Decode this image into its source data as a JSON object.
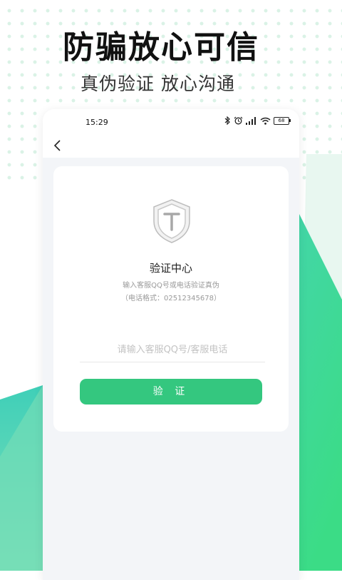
{
  "promo": {
    "headline": "防骗放心可信",
    "subheadline": "真伪验证 放心沟通"
  },
  "status_bar": {
    "time": "15:29",
    "battery": "68",
    "icons": [
      "bluetooth-icon",
      "alarm-icon",
      "signal-icon",
      "wifi-icon",
      "battery-icon"
    ]
  },
  "nav": {
    "back_icon": "chevron-left-icon"
  },
  "card": {
    "title": "验证中心",
    "description": "输入客服QQ号或电话验证真伪",
    "hint": "（电话格式：02512345678）",
    "input": {
      "value": "",
      "placeholder": "请输入客服QQ号/客服电话"
    },
    "button_label": "验 证"
  },
  "colors": {
    "accent_green": "#34c77f",
    "teal": "#3ccfb0",
    "background": "#f3f5f8"
  }
}
